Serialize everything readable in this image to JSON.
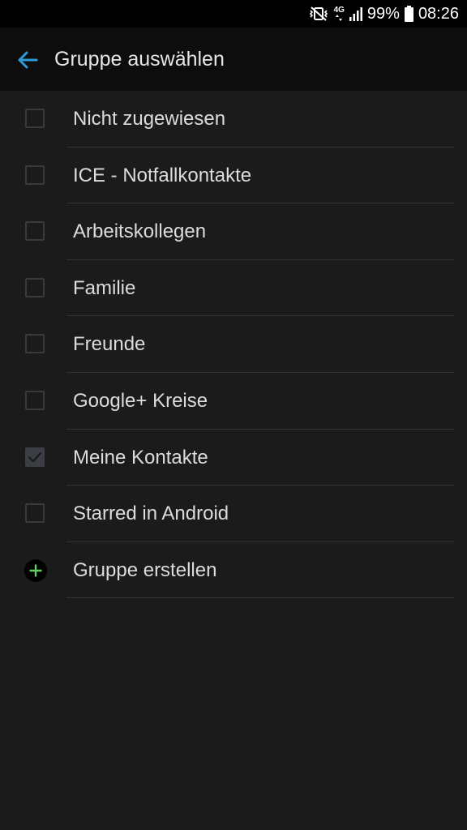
{
  "status_bar": {
    "network": "4G",
    "battery": "99%",
    "time": "08:26"
  },
  "app_bar": {
    "title": "Gruppe auswählen"
  },
  "groups": [
    {
      "label": "Nicht zugewiesen",
      "checked": false
    },
    {
      "label": "ICE - Notfallkontakte",
      "checked": false
    },
    {
      "label": "Arbeitskollegen",
      "checked": false
    },
    {
      "label": "Familie",
      "checked": false
    },
    {
      "label": "Freunde",
      "checked": false
    },
    {
      "label": "Google+ Kreise",
      "checked": false
    },
    {
      "label": "Meine Kontakte",
      "checked": true
    },
    {
      "label": "Starred in Android",
      "checked": false
    }
  ],
  "create_group": {
    "label": "Gruppe erstellen"
  },
  "colors": {
    "accent": "#2f9ad8",
    "plus": "#5fd15f"
  }
}
